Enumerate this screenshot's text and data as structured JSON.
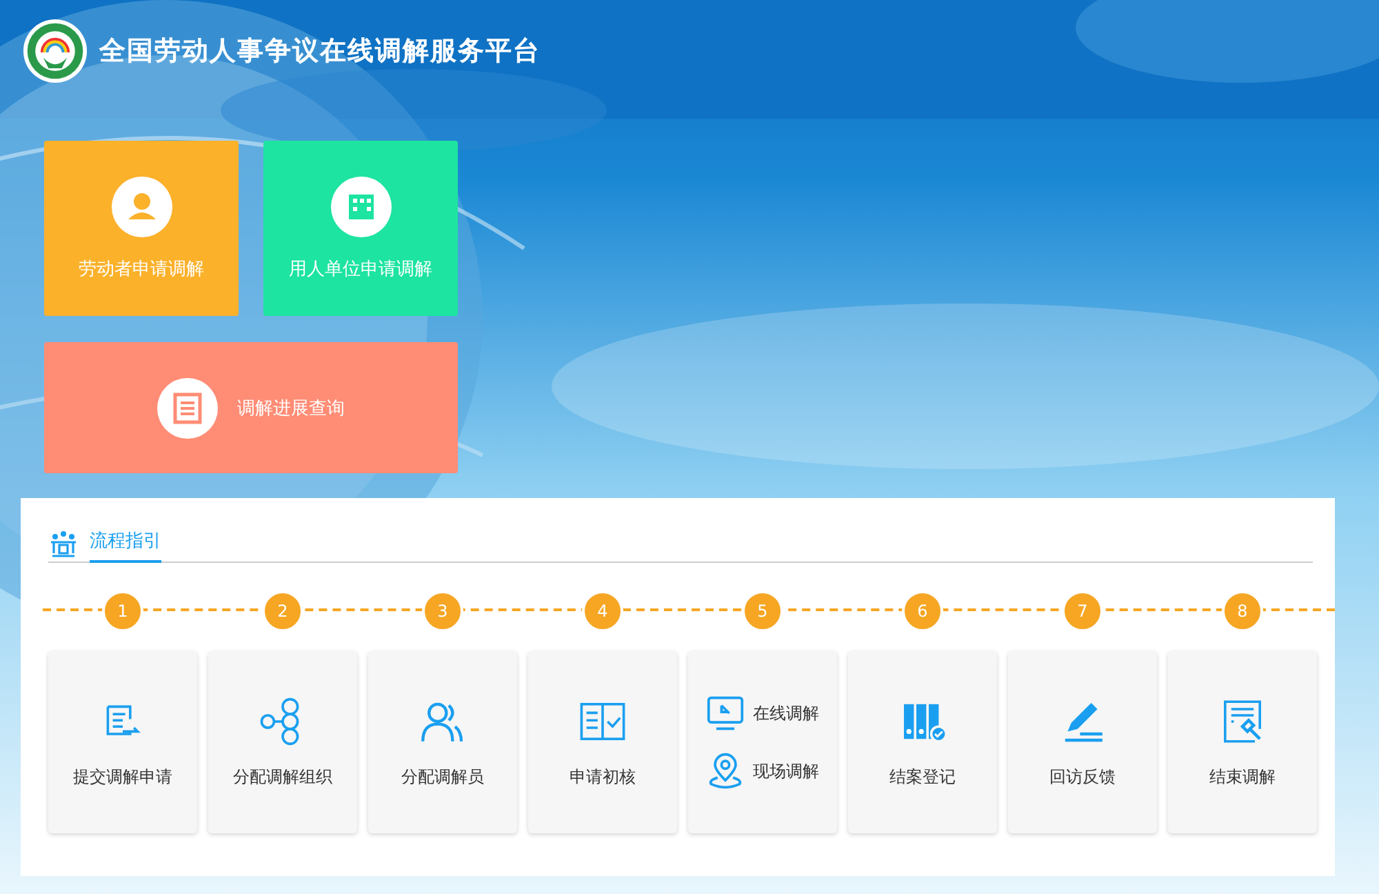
{
  "header": {
    "title": "全国劳动人事争议在线调解服务平台"
  },
  "tiles": [
    {
      "label": "劳动者申请调解",
      "color": "#fbb12a",
      "wide": false
    },
    {
      "label": "用人单位申请调解",
      "color": "#1de4a0",
      "wide": false
    },
    {
      "label": "调解进展查询",
      "color": "#ff8c75",
      "wide": true
    }
  ],
  "guide": {
    "tab": {
      "label": "流程指引",
      "selected": true
    },
    "steps": [
      {
        "number": "1",
        "kind": "single",
        "label": "提交调解申请"
      },
      {
        "number": "2",
        "kind": "single",
        "label": "分配调解组织"
      },
      {
        "number": "3",
        "kind": "single",
        "label": "分配调解员"
      },
      {
        "number": "4",
        "kind": "single",
        "label": "申请初核"
      },
      {
        "number": "5",
        "kind": "dual",
        "items": [
          {
            "label": "在线调解"
          },
          {
            "label": "现场调解"
          }
        ]
      },
      {
        "number": "6",
        "kind": "single",
        "label": "结案登记"
      },
      {
        "number": "7",
        "kind": "single",
        "label": "回访反馈"
      },
      {
        "number": "8",
        "kind": "single",
        "label": "结束调解"
      }
    ]
  }
}
